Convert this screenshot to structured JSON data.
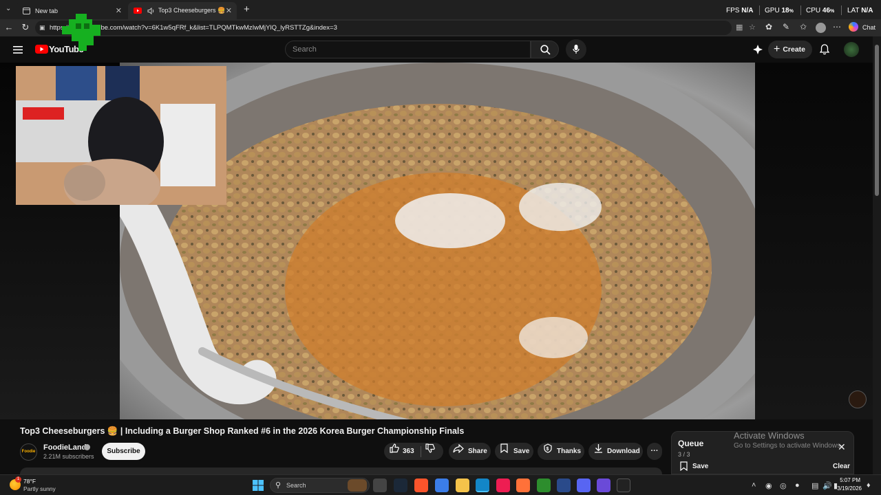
{
  "browser": {
    "tabs": [
      {
        "title": "New tab"
      },
      {
        "title": "Top3 Cheeseburgers 🍔 | Inclu"
      }
    ],
    "new_tab_symbol": "+",
    "url": "https://www.youtube.com/watch?v=6K1w5qFRf_k&list=TLPQMTkwMzIwMjYlQ_lyRSTTZg&index=3",
    "chat_label": "Chat"
  },
  "system_monitor": {
    "fps_label": "FPS",
    "fps_value": "N/A",
    "gpu_label": "GPU",
    "gpu_value": "18",
    "cpu_label": "CPU",
    "cpu_value": "46",
    "lat_label": "LAT",
    "lat_value": "N/A",
    "percent": "%"
  },
  "youtube": {
    "logo_text": "YouTube",
    "search_placeholder": "Search",
    "create_label": "Create"
  },
  "video": {
    "title": "Top3 Cheeseburgers 🍔 | Including a Burger Shop Ranked #6 in the 2026 Korea Burger Championship Finals",
    "channel": "FoodieLand",
    "channel_avatar_text": "Foodie",
    "subscribers": "2.21M subscribers",
    "subscribe_label": "Subscribe",
    "likes": "363",
    "share_label": "Share",
    "save_label": "Save",
    "thanks_label": "Thanks",
    "download_label": "Download",
    "more_label": "···"
  },
  "queue": {
    "title": "Queue",
    "position": "3 / 3",
    "save_label": "Save",
    "clear_label": "Clear"
  },
  "watermark": {
    "title": "Activate Windows",
    "subtitle": "Go to Settings to activate Windows."
  },
  "taskbar": {
    "weather_temp": "78°F",
    "weather_desc": "Partly sunny",
    "weather_badge": "1",
    "search_placeholder": "Search",
    "time": "5:07 PM",
    "date": "3/19/2026"
  },
  "colors": {
    "youtube_red": "#ff0000",
    "background": "#0f0f0f",
    "pill": "#272727"
  }
}
